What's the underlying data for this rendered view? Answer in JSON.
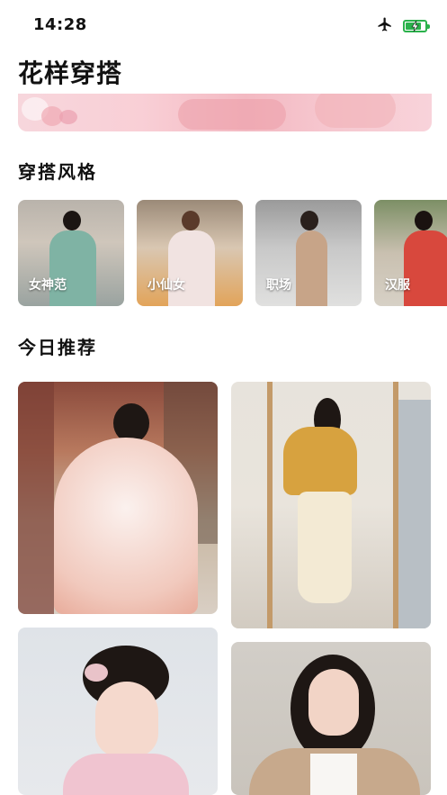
{
  "status": {
    "time": "14:28",
    "airplane_icon": "airplane-icon",
    "battery_icon": "battery-charging-icon",
    "battery_level": 0.75
  },
  "page": {
    "title": "花样穿搭"
  },
  "sections": {
    "styles_title": "穿搭风格",
    "recommend_title": "今日推荐"
  },
  "styles": [
    {
      "label": "女神范"
    },
    {
      "label": "小仙女"
    },
    {
      "label": "职场"
    },
    {
      "label": "汉服"
    }
  ],
  "recommendations": [
    {
      "name": "hanfu-pink-dance-photo"
    },
    {
      "name": "mirror-selfie-yellow-sweater-photo"
    },
    {
      "name": "hanfu-hairpin-portrait-photo"
    },
    {
      "name": "beige-blazer-portrait-photo"
    }
  ],
  "colors": {
    "battery": "#2bb24c",
    "banner_pink": "#f6c7cf"
  }
}
